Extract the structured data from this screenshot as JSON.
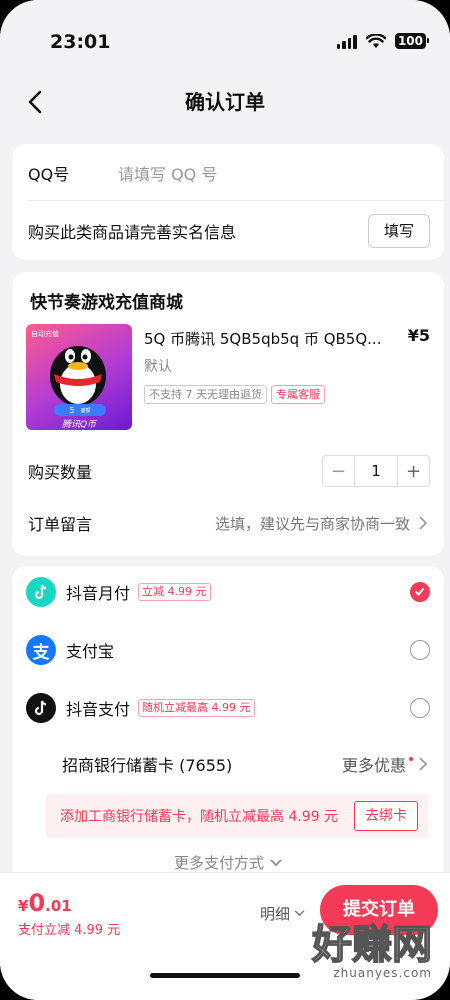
{
  "status": {
    "time": "23:01",
    "battery": "100"
  },
  "nav": {
    "title": "确认订单"
  },
  "account": {
    "qq_label": "QQ号",
    "qq_placeholder": "请填写 QQ 号",
    "realname_text": "购买此类商品请完善实名信息",
    "fill_button": "填写"
  },
  "store": {
    "name": "快节奏游戏充值商城",
    "image_badge_top": "自动充值",
    "image_amount": "5",
    "image_unit": "面额",
    "image_caption": "腾讯Q币",
    "product_title": "5Q 币腾讯 5QB5qb5q 币 QB5Q...",
    "price": "¥5",
    "variant": "默认",
    "tags": [
      "不支持 7 天无理由退货",
      "专属客服"
    ],
    "quantity_label": "购买数量",
    "quantity": "1",
    "minus": "−",
    "plus": "+",
    "note_label": "订单留言",
    "note_placeholder": "选填，建议先与商家协商一致"
  },
  "payment": {
    "methods": [
      {
        "name": "抖音月付",
        "tag": "立减 4.99 元",
        "selected": true
      },
      {
        "name": "支付宝",
        "tag": "",
        "selected": false
      },
      {
        "name": "抖音支付",
        "tag": "随机立减最高 4.99 元",
        "selected": false
      }
    ],
    "bank_card": "招商银行储蓄卡 (7655)",
    "more_discounts": "更多优惠",
    "promo_text": "添加工商银行储蓄卡，随机立减最高 4.99 元",
    "promo_button": "去绑卡",
    "more_methods": "更多支付方式"
  },
  "footer": {
    "currency": "¥",
    "price_int": "0",
    "price_dec": ".01",
    "discount": "支付立减 4.99 元",
    "details": "明细",
    "submit": "提交订单"
  },
  "watermark": {
    "text": "好赚网",
    "url": "zhuanyes.com"
  },
  "colors": {
    "accent": "#f33a57",
    "background": "#f3f3f6",
    "alipay": "#1677ff"
  },
  "icons": [
    "back-icon",
    "signal-icon",
    "wifi-icon",
    "battery-icon",
    "douyin-icon",
    "alipay-icon",
    "chevron-right-icon",
    "chevron-down-icon",
    "check-icon"
  ]
}
